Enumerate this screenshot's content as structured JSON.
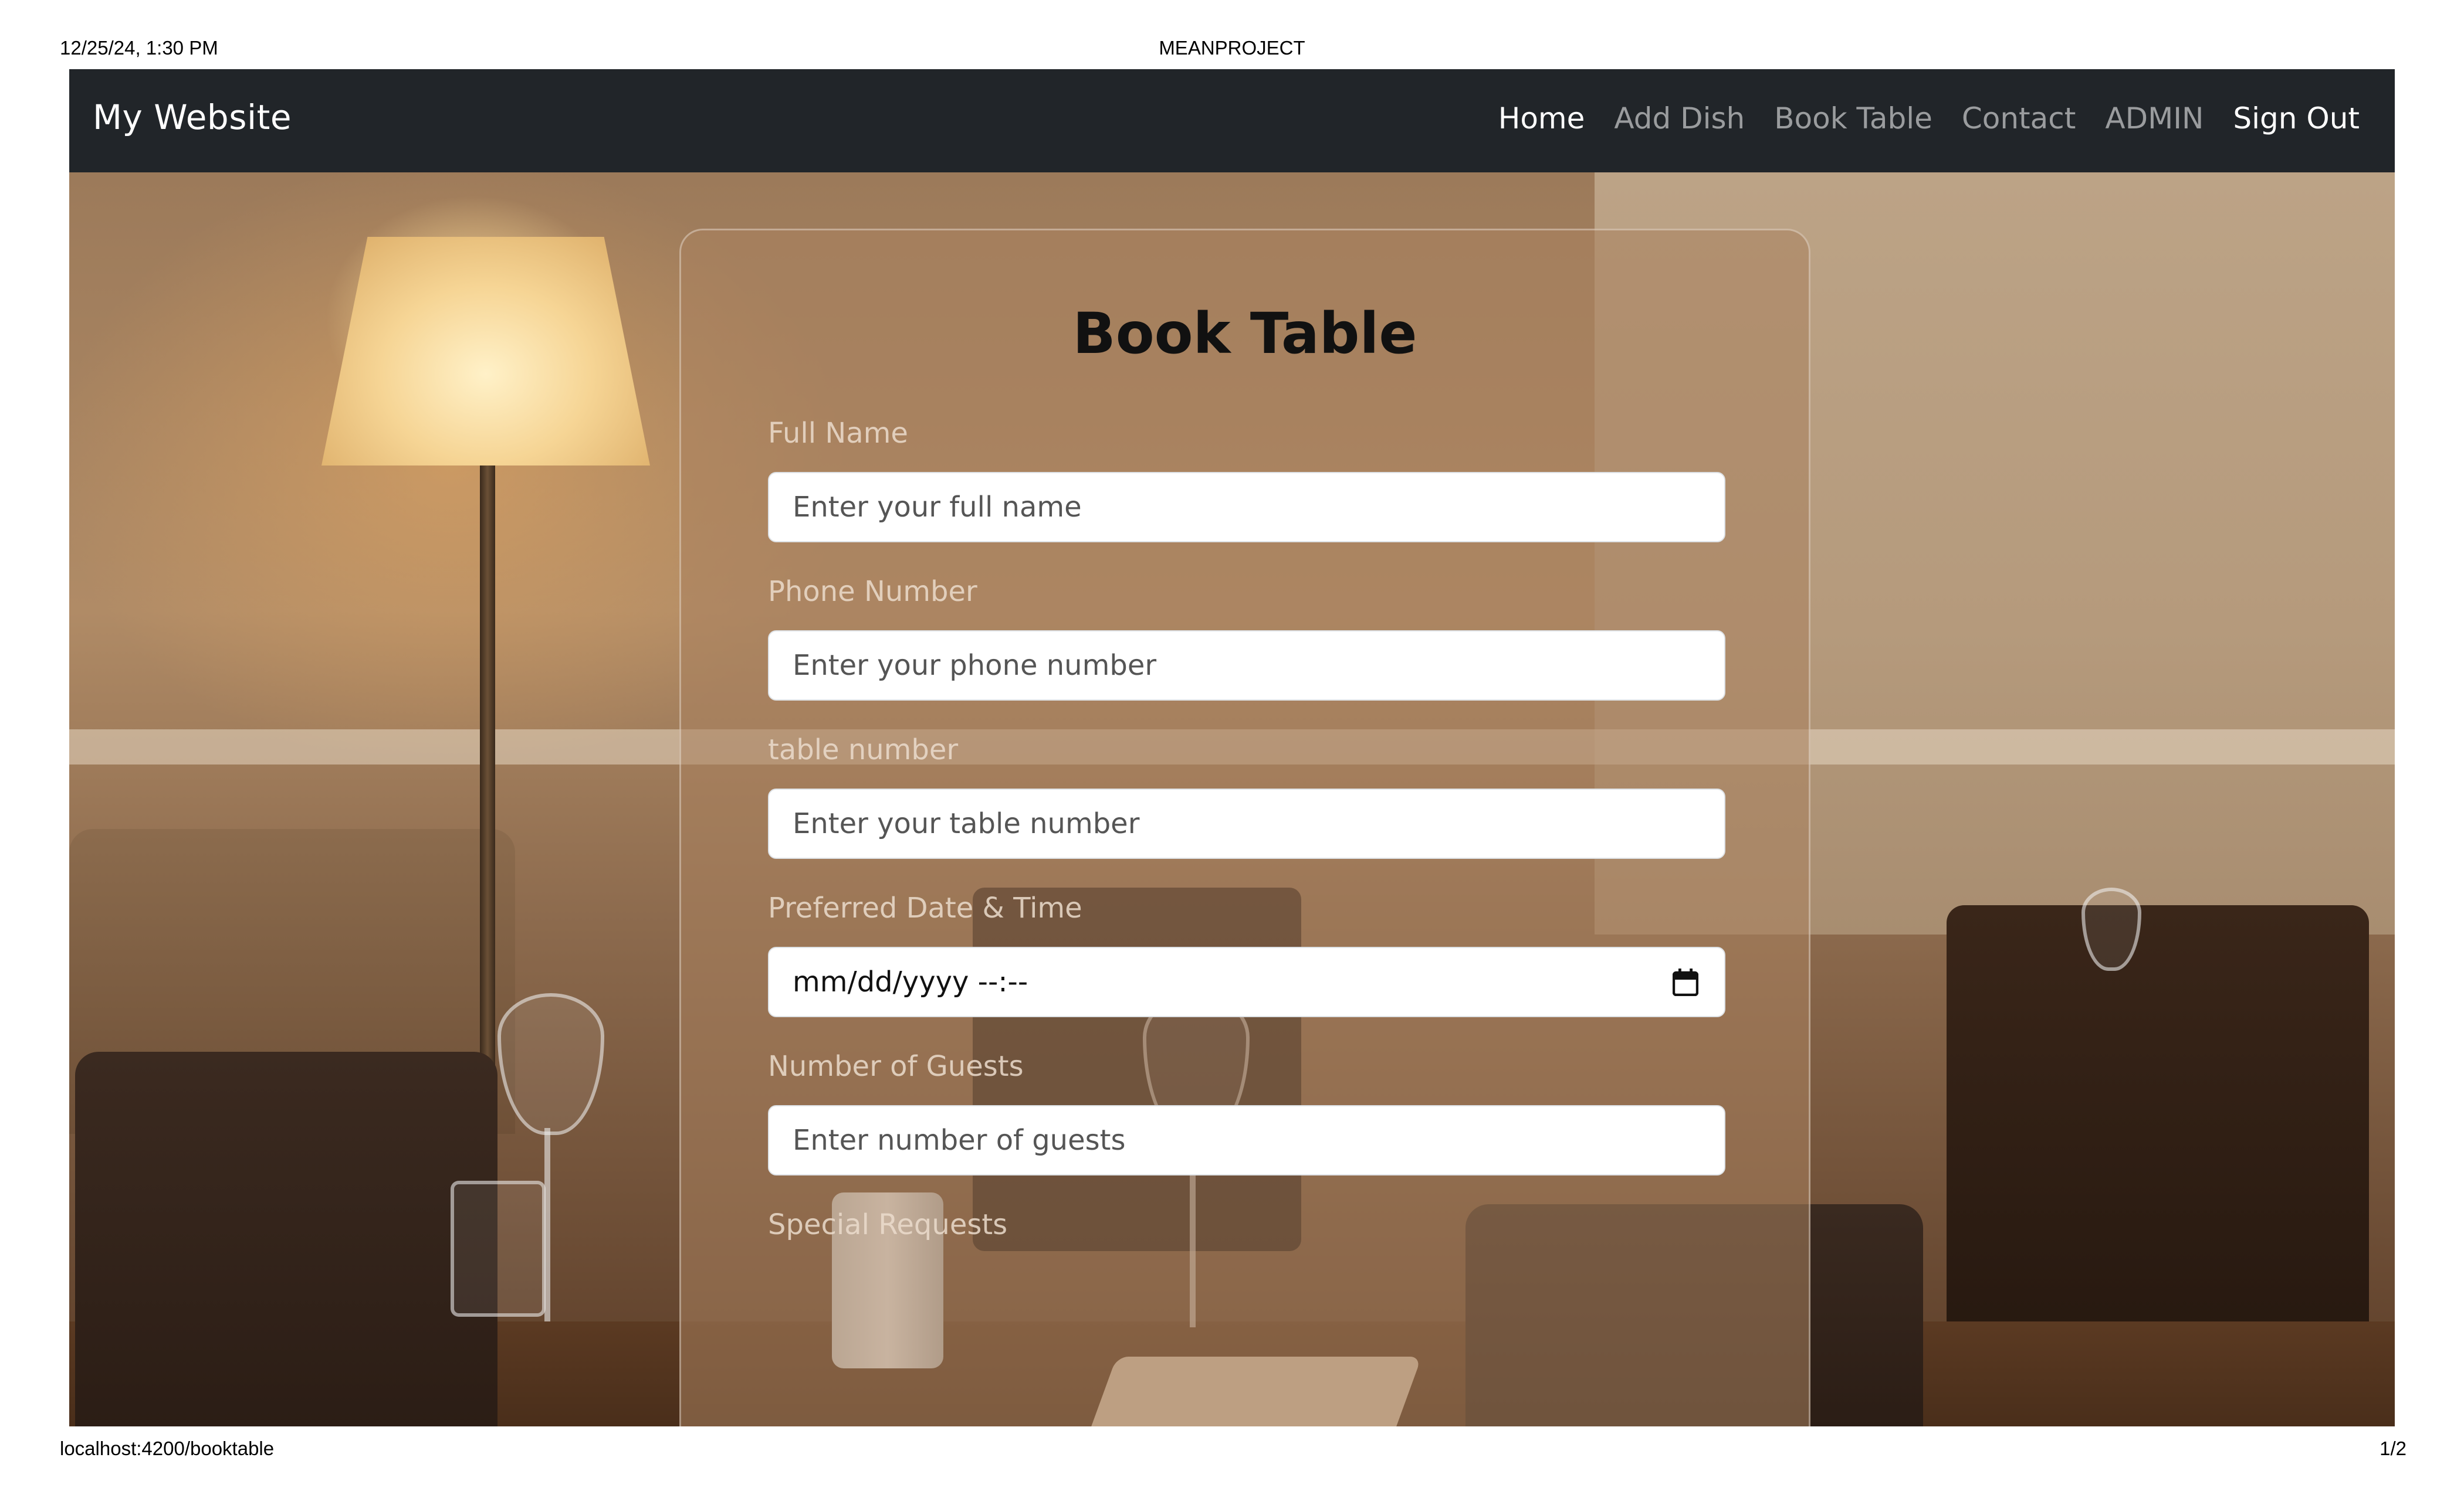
{
  "print": {
    "date": "12/25/24, 1:30 PM",
    "title": "MEANPROJECT",
    "url": "localhost:4200/booktable",
    "page": "1/2"
  },
  "navbar": {
    "brand": "My Website",
    "links": [
      {
        "label": "Home"
      },
      {
        "label": "Add Dish"
      },
      {
        "label": "Book Table"
      },
      {
        "label": "Contact"
      },
      {
        "label": "ADMIN"
      },
      {
        "label": "Sign Out"
      }
    ]
  },
  "form": {
    "title": "Book Table",
    "fields": [
      {
        "label": "Full Name",
        "placeholder": "Enter your full name"
      },
      {
        "label": "Phone Number",
        "placeholder": "Enter your phone number"
      },
      {
        "label": "table number",
        "placeholder": "Enter your table number"
      },
      {
        "label": "Preferred Date & Time",
        "value": "mm/dd/yyyy --:--"
      },
      {
        "label": "Number of Guests",
        "placeholder": "Enter number of guests"
      },
      {
        "label": "Special Requests"
      }
    ]
  },
  "colors": {
    "navbar_bg": "#212529",
    "nav_active": "#ffffff",
    "nav_inactive": "#8f9296"
  },
  "icons": {
    "date_picker": "calendar-icon"
  }
}
